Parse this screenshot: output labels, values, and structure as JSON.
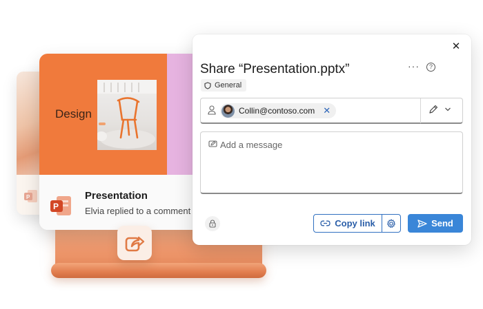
{
  "slide": {
    "design_text": "Design"
  },
  "document": {
    "title": "Presentation",
    "subtitle": "Elvia replied to a comment"
  },
  "dialog": {
    "title": "Share “Presentation.pptx”",
    "close_glyph": "✕",
    "more_glyph": "···",
    "help_glyph": "?",
    "sensitivity_label": "General",
    "recipient": {
      "email": "Collin@contoso.com",
      "remove_glyph": "✕"
    },
    "message_placeholder": "Add a message",
    "copy_link_label": "Copy link",
    "send_label": "Send"
  },
  "icons": {
    "powerpoint": "powerpoint-icon",
    "share": "share-arrow-icon",
    "shield": "shield-icon",
    "person": "person-icon",
    "pencil": "pencil-icon",
    "chevron": "chevron-down-icon",
    "message": "message-edit-icon",
    "lock": "lock-icon",
    "link": "link-icon",
    "gear": "gear-icon",
    "send": "send-icon"
  },
  "colors": {
    "slide_orange": "#f07a3c",
    "slide_lilac": "#e6b3e0",
    "accent_blue": "#3a86d8",
    "link_blue": "#2a5ea8",
    "powerpoint_red": "#d24726"
  }
}
